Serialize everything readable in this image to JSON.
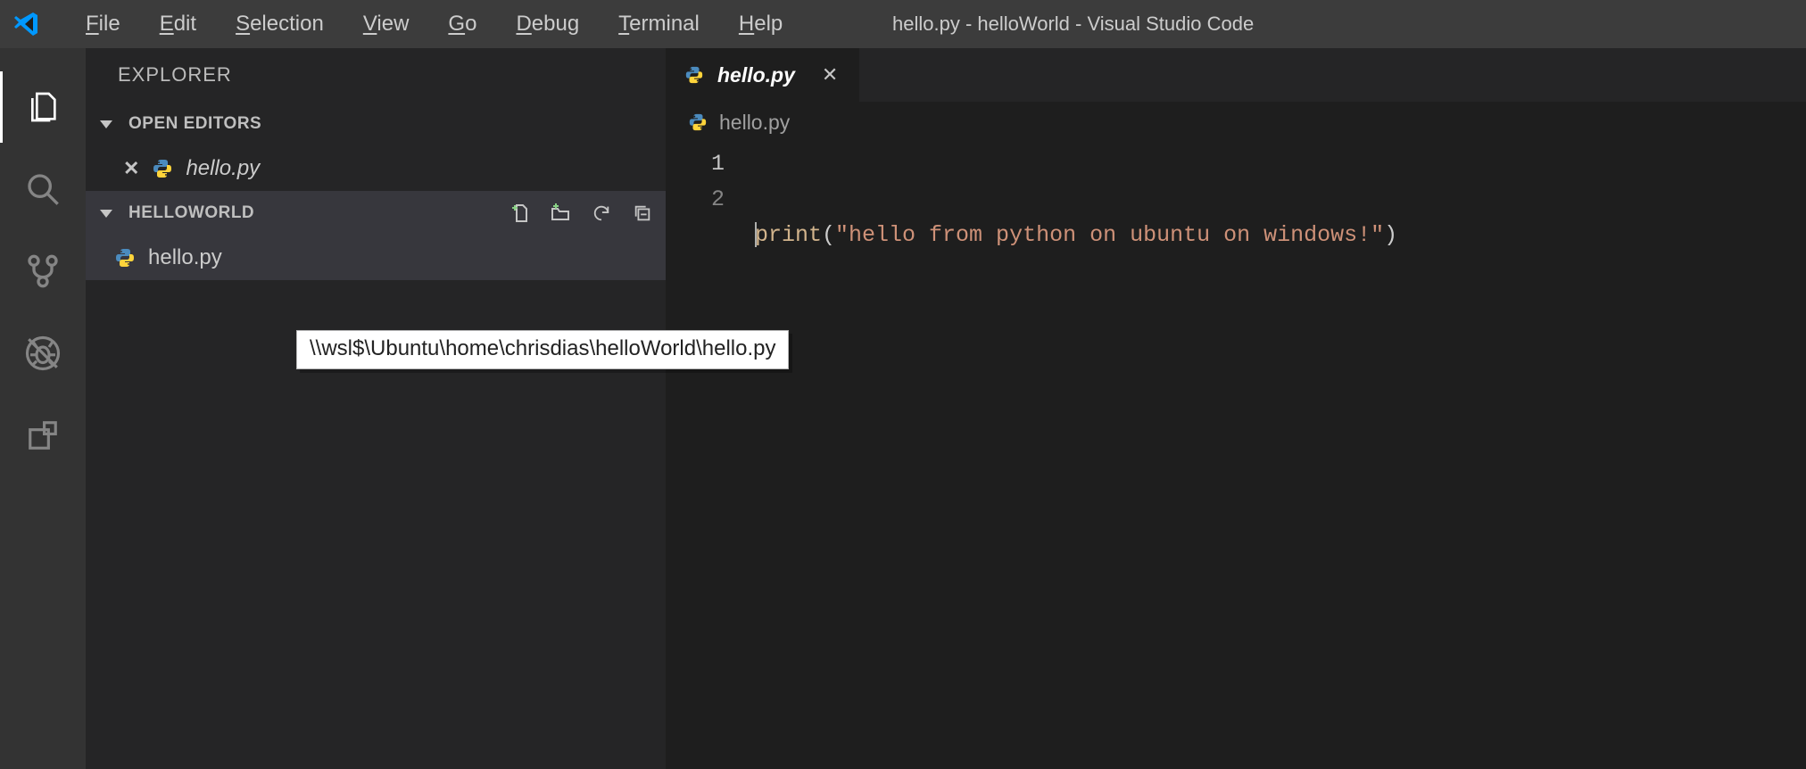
{
  "window": {
    "title": "hello.py - helloWorld - Visual Studio Code"
  },
  "menu": {
    "file": {
      "label": "File",
      "accel": "F"
    },
    "edit": {
      "label": "Edit",
      "accel": "E"
    },
    "selection": {
      "label": "Selection",
      "accel": "S"
    },
    "view": {
      "label": "View",
      "accel": "V"
    },
    "go": {
      "label": "Go",
      "accel": "G"
    },
    "debug": {
      "label": "Debug",
      "accel": "D"
    },
    "terminal": {
      "label": "Terminal",
      "accel": "T"
    },
    "help": {
      "label": "Help",
      "accel": "H"
    }
  },
  "sidebar": {
    "title": "EXPLORER",
    "open_editors_label": "OPEN EDITORS",
    "workspace_label": "HELLOWORLD",
    "open_editor_item": "hello.py",
    "workspace_file": "hello.py"
  },
  "tab": {
    "label": "hello.py",
    "breadcrumb": "hello.py"
  },
  "code": {
    "ln1": "1",
    "ln2": "2",
    "fn": "print",
    "open": "(",
    "str": "\"hello from python on ubuntu on windows!\"",
    "close": ")"
  },
  "tooltip": {
    "text": "\\\\wsl$\\Ubuntu\\home\\chrisdias\\helloWorld\\hello.py"
  }
}
